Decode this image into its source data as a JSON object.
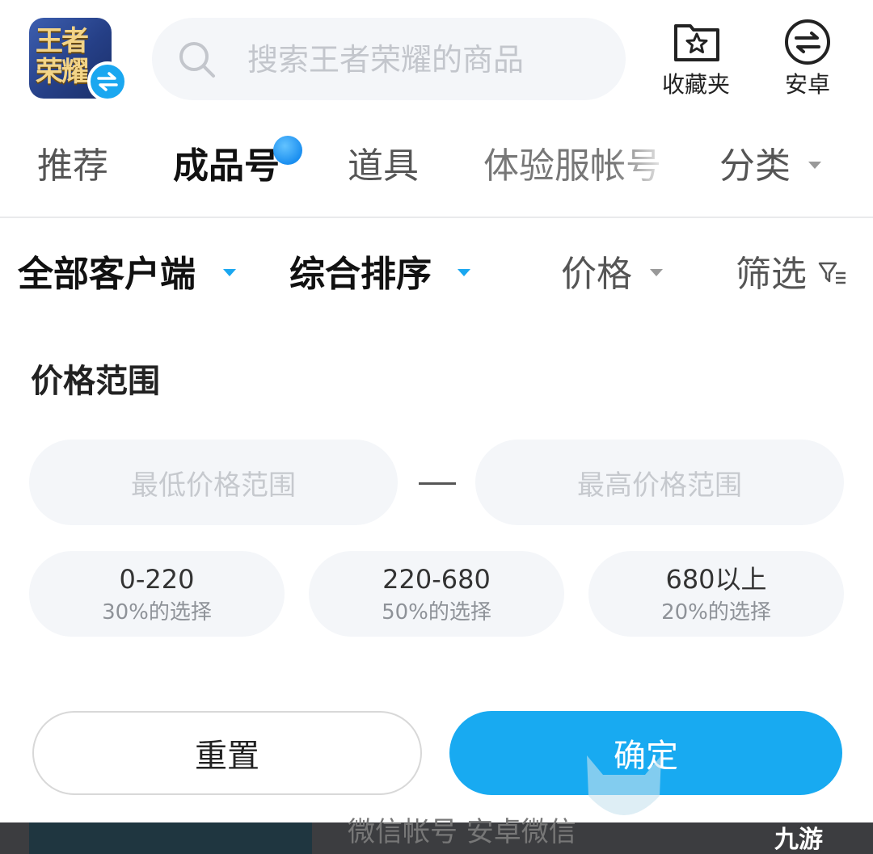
{
  "header": {
    "app_icon_text_line1": "王者",
    "app_icon_text_line2": "荣耀",
    "search_placeholder": "搜索王者荣耀的商品",
    "favorites_label": "收藏夹",
    "android_label": "安卓"
  },
  "tabs": [
    {
      "label": "推荐"
    },
    {
      "label": "成品号"
    },
    {
      "label": "道具"
    },
    {
      "label": "体验服帐号"
    },
    {
      "label": "分类"
    }
  ],
  "filters": {
    "client": "全部客户端",
    "sort": "综合排序",
    "price": "价格",
    "filter": "筛选"
  },
  "price_panel": {
    "title": "价格范围",
    "min_placeholder": "最低价格范围",
    "max_placeholder": "最高价格范围",
    "chips": [
      {
        "range": "0-220",
        "percent": "30%的选择"
      },
      {
        "range": "220-680",
        "percent": "50%的选择"
      },
      {
        "range": "680以上",
        "percent": "20%的选择"
      }
    ],
    "reset_label": "重置",
    "confirm_label": "确定"
  },
  "background_peek_text": "微信帐号 安卓微信",
  "watermark": "九游",
  "colors": {
    "accent": "#18aaf1",
    "input_bg": "#f4f6f9",
    "placeholder": "#c6c9ce"
  }
}
